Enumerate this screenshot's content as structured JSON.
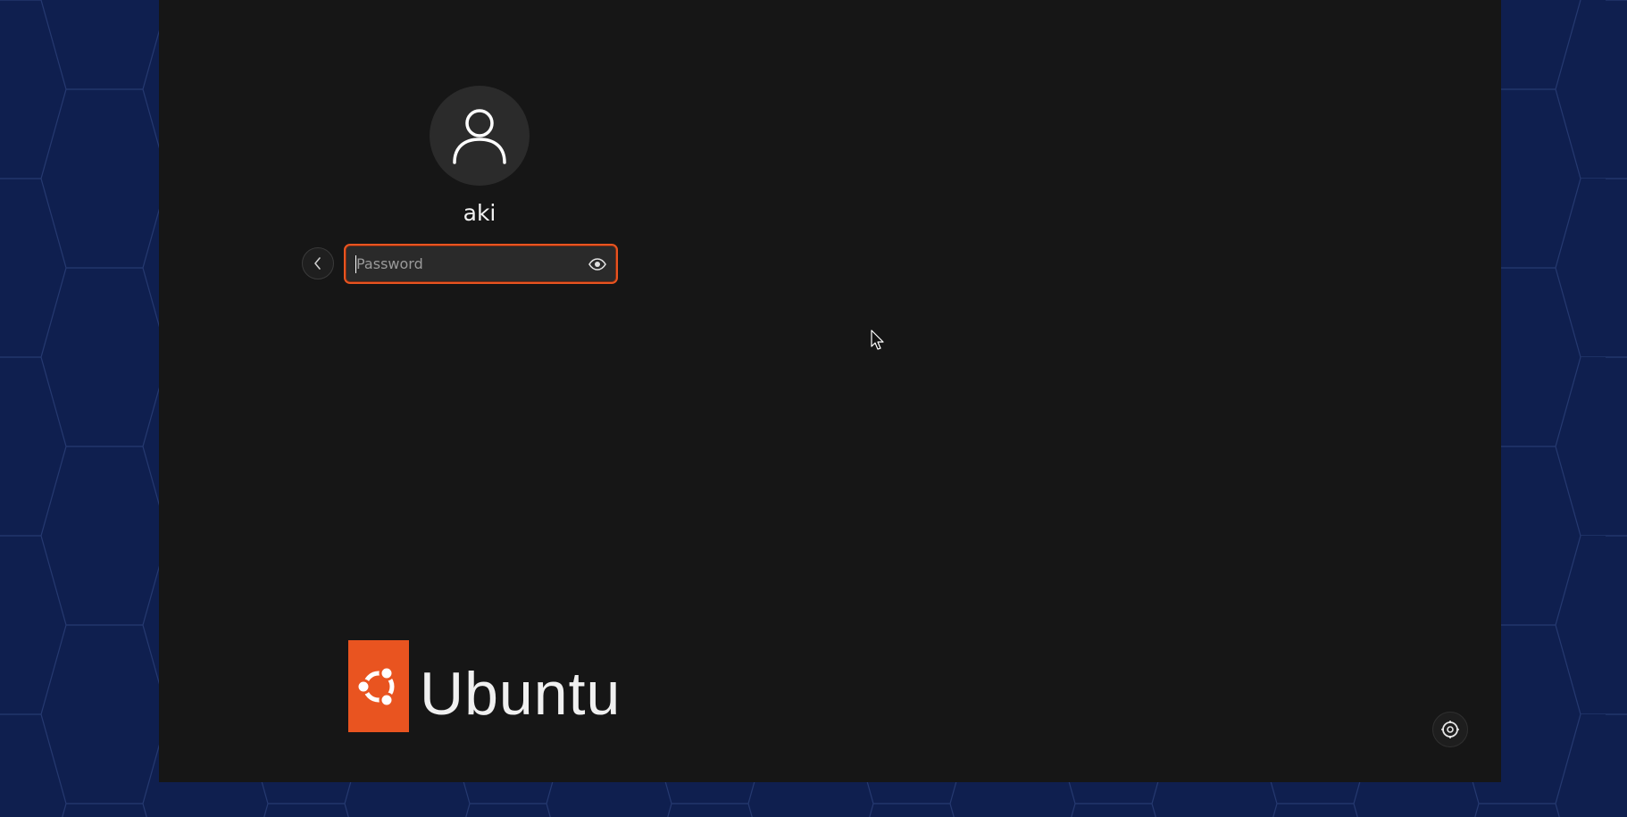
{
  "login": {
    "username": "aki",
    "password_placeholder": "Password",
    "password_value": ""
  },
  "branding": {
    "logo_text": "Ubuntu",
    "accent_color": "#e95420"
  },
  "background": {
    "outer_color": "#0f1f4f",
    "screen_color": "#161616"
  },
  "icons": {
    "avatar": "user-icon",
    "back": "chevron-left-icon",
    "reveal": "eye-icon",
    "accessibility": "accessibility-icon",
    "logo": "ubuntu-circle-of-friends-icon",
    "pointer": "mouse-pointer-icon"
  }
}
